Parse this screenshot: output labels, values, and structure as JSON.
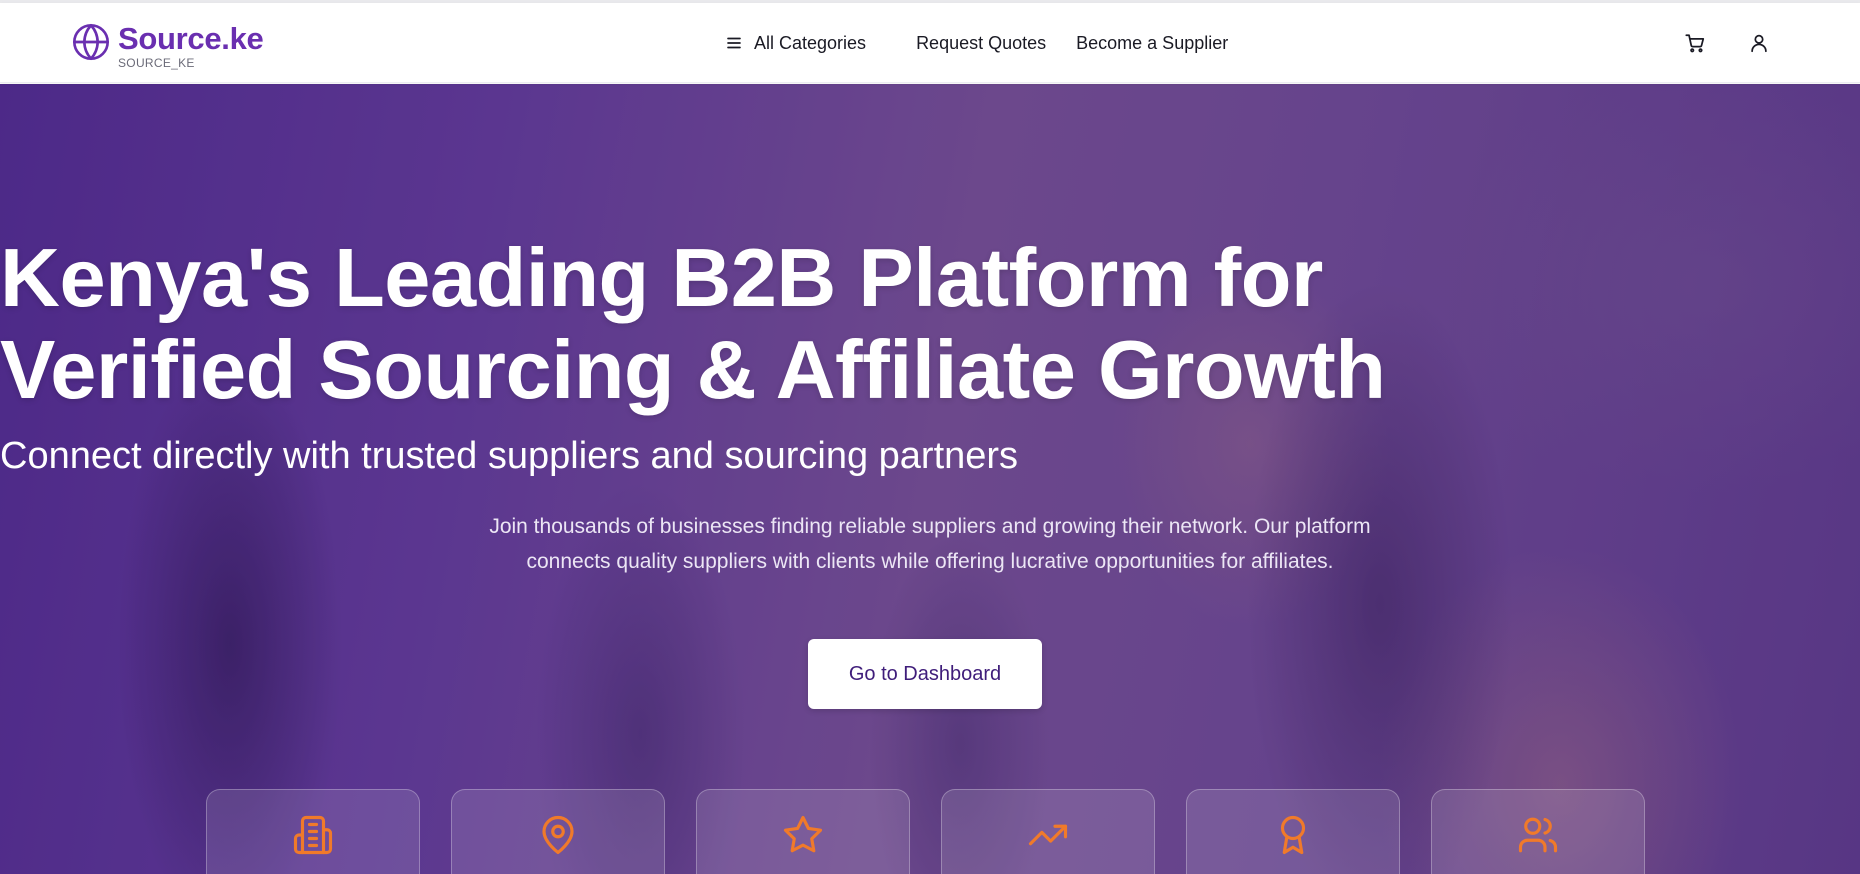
{
  "brand": {
    "name": "Source.ke",
    "subtitle": "SOURCE_KE",
    "icon": "globe-icon",
    "color": "#6a2fb0"
  },
  "nav": {
    "categories_label": "All Categories",
    "request_quotes_label": "Request Quotes",
    "become_supplier_label": "Become a Supplier",
    "icons": [
      "menu-icon",
      "cart-icon",
      "user-icon"
    ]
  },
  "hero": {
    "title_line1": "Kenya's Leading B2B Platform for",
    "title_line2": "Verified Sourcing & Affiliate Growth",
    "subtitle": "Connect directly with trusted suppliers and sourcing partners",
    "description_line1": "Join thousands of businesses finding reliable suppliers and growing their network. Our platform",
    "description_line2": "connects quality suppliers with clients while offering lucrative opportunities for affiliates.",
    "cta_label": "Go to Dashboard"
  },
  "feature_cards": [
    {
      "icon": "building-icon"
    },
    {
      "icon": "map-pin-icon"
    },
    {
      "icon": "star-icon"
    },
    {
      "icon": "trending-up-icon"
    },
    {
      "icon": "award-icon"
    },
    {
      "icon": "users-icon"
    }
  ],
  "colors": {
    "accent_orange": "#f07a2a",
    "hero_purple": "#5e3a94",
    "cta_text": "#3f1d7a"
  }
}
